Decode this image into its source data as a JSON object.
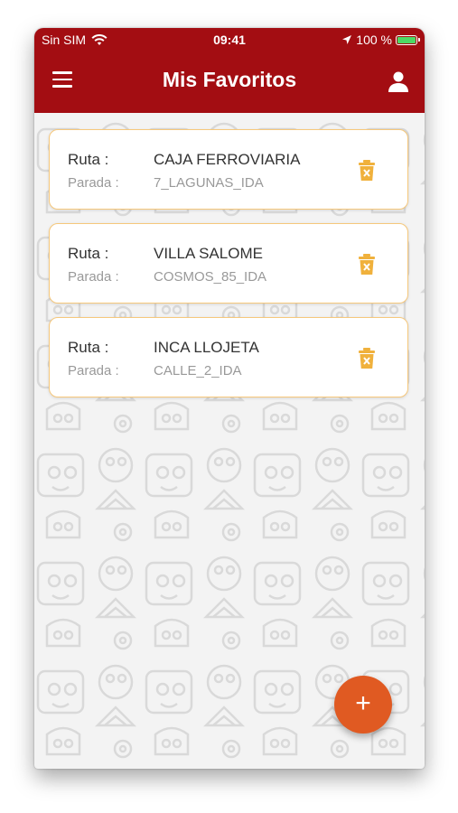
{
  "status_bar": {
    "carrier": "Sin SIM",
    "time": "09:41",
    "battery": "100 %"
  },
  "app_bar": {
    "title": "Mis Favoritos",
    "menu_icon": "hamburger-menu-icon",
    "user_icon": "user-icon"
  },
  "favorites": [
    {
      "route_label": "Ruta :",
      "route": "CAJA FERROVIARIA",
      "stop_label": "Parada :",
      "stop": "7_LAGUNAS_IDA"
    },
    {
      "route_label": "Ruta :",
      "route": "VILLA SALOME",
      "stop_label": "Parada :",
      "stop": "COSMOS_85_IDA"
    },
    {
      "route_label": "Ruta :",
      "route": "INCA LLOJETA",
      "stop_label": "Parada :",
      "stop": "CALLE_2_IDA"
    }
  ],
  "fab": {
    "label": "+"
  },
  "colors": {
    "primary": "#a30d12",
    "accent": "#e05a22",
    "card_border": "#f6c87c",
    "trash": "#f0b13c"
  }
}
